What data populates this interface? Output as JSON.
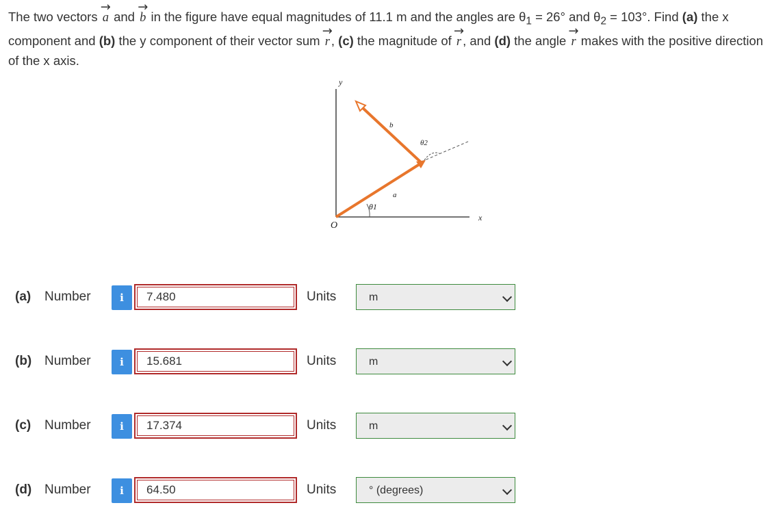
{
  "question": {
    "intro": "The two vectors",
    "vec_a": "a",
    "and1": "and",
    "vec_b": "b",
    "text1": "in the figure have equal magnitudes of 11.1 m and the angles are θ",
    "sub1": "1",
    "text2": " = 26° and θ",
    "sub2": "2",
    "text3": " = 103°. Find ",
    "part_a": "(a)",
    "text4": " the x component and ",
    "part_b": "(b)",
    "text5": " the y component of their vector sum",
    "vec_r1": "r",
    "text6": ",",
    "part_c": "(c)",
    "text7": " the magnitude of",
    "vec_r2": "r",
    "text8": ", and ",
    "part_d": "(d)",
    "text9": " the angle",
    "vec_r3": "r",
    "text10": "makes with the positive direction of the x axis."
  },
  "figure": {
    "y_axis_label": "y",
    "x_axis_label": "x",
    "origin_label": "O",
    "theta1_label": "θ1",
    "theta2_label": "θ2",
    "vec_a_label": "a",
    "vec_b_label": "b",
    "colors": {
      "vector": "#e8762c",
      "axis": "#222222",
      "dashed": "#555555"
    }
  },
  "rows": [
    {
      "part": "(a)",
      "number_label": "Number",
      "info": "i",
      "value": "7.480",
      "units_label": "Units",
      "unit": "m"
    },
    {
      "part": "(b)",
      "number_label": "Number",
      "info": "i",
      "value": "15.681",
      "units_label": "Units",
      "unit": "m"
    },
    {
      "part": "(c)",
      "number_label": "Number",
      "info": "i",
      "value": "17.374",
      "units_label": "Units",
      "unit": "m"
    },
    {
      "part": "(d)",
      "number_label": "Number",
      "info": "i",
      "value": "64.50",
      "units_label": "Units",
      "unit": "° (degrees)"
    }
  ]
}
